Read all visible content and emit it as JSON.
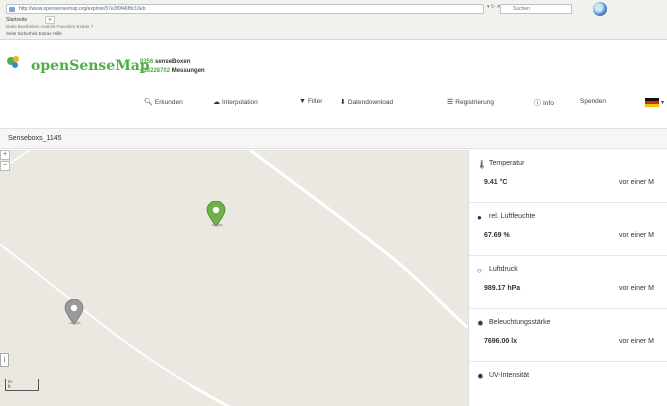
{
  "browser": {
    "address": "http://www.opensensemap.org/explore/57e3f0f46f8c10eb",
    "search_placeholder": "Suchen",
    "tab_label": "Startseite",
    "menu": "Datei  Bearbeiten  Ansicht  Favoriten  Extras  ?",
    "favorites": "Seite  Sicherheit  Extras  Hilfe"
  },
  "header": {
    "logo_text": "openSenseMap",
    "stat1_num": "9356",
    "stat1_label": "senseBoxen",
    "stat2_num": "438228702",
    "stat2_label": "Messungen"
  },
  "nav": {
    "explore": "Erkunden",
    "interpolation": "Interpolation",
    "filter": "Filter",
    "download": "Datendownload",
    "register": "Registrierung",
    "info": "Info",
    "donate": "Spenden"
  },
  "sensebox": {
    "title": "Senseboxs_1145"
  },
  "sensors": [
    {
      "icon": "thermometer-icon",
      "glyph": "🌡",
      "title": "Temperatur",
      "value": "9.41 °C",
      "time": "vor einer M"
    },
    {
      "icon": "droplet-icon",
      "glyph": "●",
      "title": "rel. Luftfeuchte",
      "value": "67.69 %",
      "time": "vor einer M"
    },
    {
      "icon": "gauge-icon",
      "glyph": "○",
      "title": "Luftdruck",
      "value": "989.17 hPa",
      "time": "vor einer M"
    },
    {
      "icon": "sun-icon",
      "glyph": "✹",
      "title": "Beleuchtungsstärke",
      "value": "7696.00 lx",
      "time": "vor einer M"
    },
    {
      "icon": "sun-icon",
      "glyph": "✹",
      "title": "UV-Intensität",
      "value": "",
      "time": ""
    }
  ],
  "map": {
    "left_button": ")",
    "scale_labels": [
      "m",
      "ft"
    ]
  },
  "colors": {
    "brand_green": "#4eaf47",
    "map_bg": "#ebe8e1"
  }
}
